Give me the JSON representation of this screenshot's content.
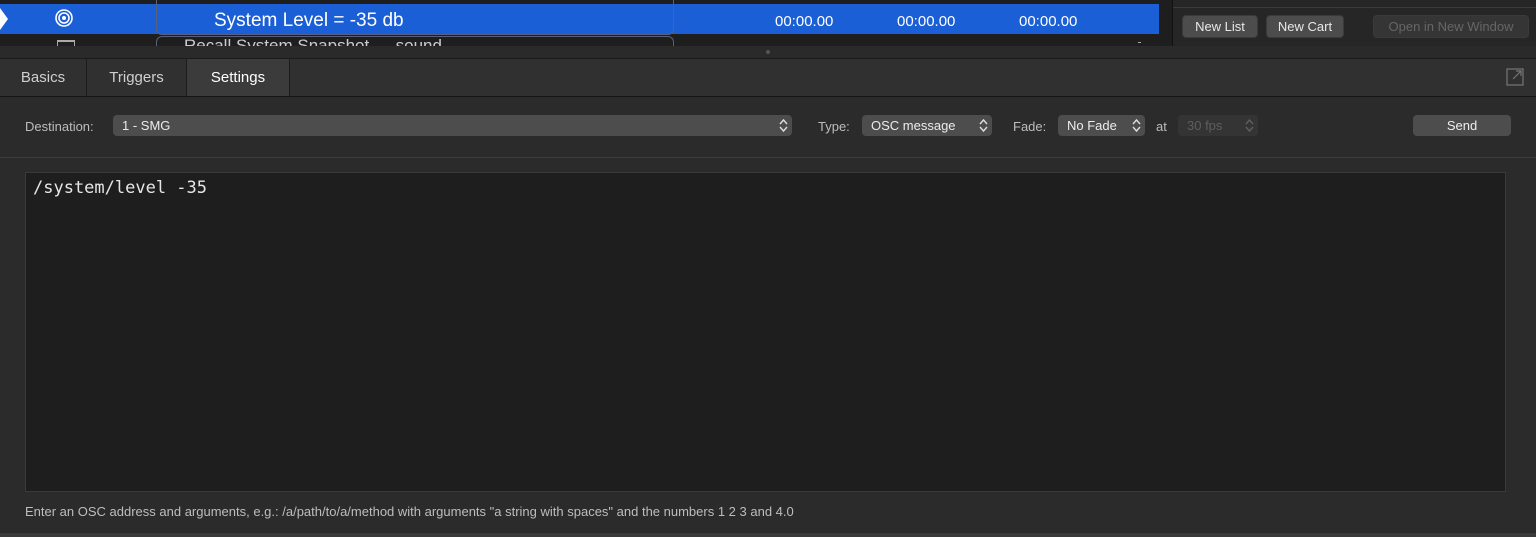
{
  "cue_list": {
    "selected_cue": {
      "name": "System Level = -35 db",
      "pre_wait": "00:00.00",
      "action": "00:00.00",
      "post_wait": "00:00.00"
    },
    "next_cue": {
      "name": "Recall System Snapshot — sound"
    }
  },
  "side_panel": {
    "new_list_label": "New List",
    "new_cart_label": "New Cart",
    "open_window_label": "Open in New Window"
  },
  "tabs": [
    {
      "label": "Basics",
      "active": false
    },
    {
      "label": "Triggers",
      "active": false
    },
    {
      "label": "Settings",
      "active": true
    }
  ],
  "settings": {
    "destination_label": "Destination:",
    "destination_value": "1 - SMG",
    "type_label": "Type:",
    "type_value": "OSC message",
    "fade_label": "Fade:",
    "fade_value": "No Fade",
    "at_label": "at",
    "fps_value": "30 fps",
    "send_label": "Send",
    "osc_text": "/system/level -35",
    "hint": "Enter an OSC address and arguments, e.g.: /a/path/to/a/method with arguments \"a string with spaces\" and the numbers 1 2 3 and 4.0"
  },
  "colors": {
    "selection_blue": "#1b5fd6",
    "background": "#2b2b2b",
    "editor_background": "#1e1e1e"
  }
}
